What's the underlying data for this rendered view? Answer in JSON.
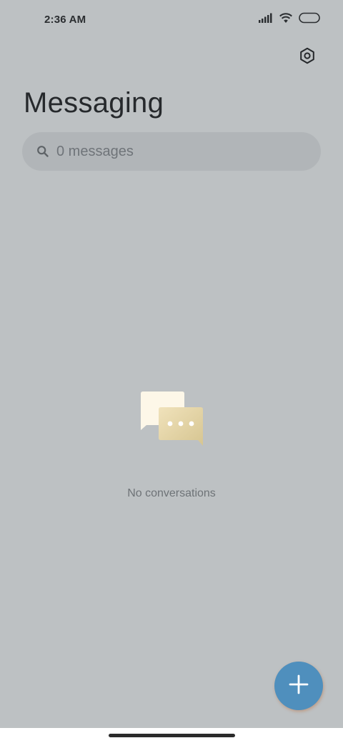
{
  "status_bar": {
    "time": "2:36 AM",
    "icons": [
      "signal-icon",
      "wifi-icon",
      "battery-icon"
    ]
  },
  "header": {
    "settings_icon": "settings-icon",
    "title": "Messaging"
  },
  "search": {
    "icon": "search-icon",
    "text": "0 messages"
  },
  "empty_state": {
    "illustration": "chat-bubbles-icon",
    "message": "No conversations"
  },
  "fab": {
    "icon": "plus-icon",
    "color": "#4f8fbd"
  },
  "colors": {
    "background": "#bdc1c3",
    "search_background": "#b1b5b8",
    "accent": "#4f8fbd"
  }
}
